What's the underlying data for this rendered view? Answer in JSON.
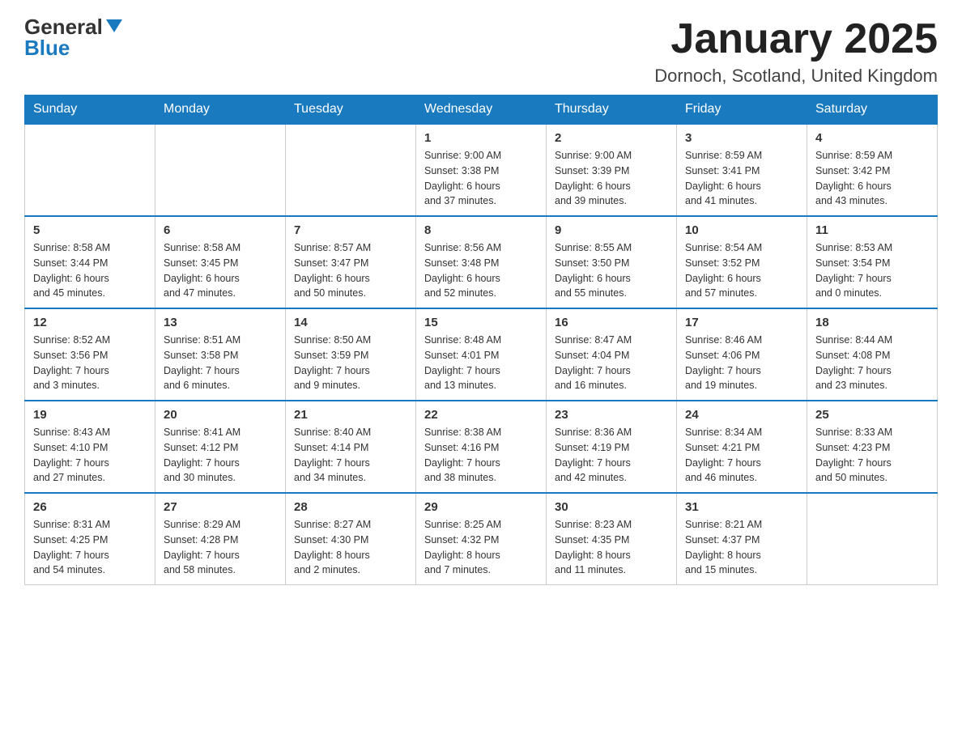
{
  "header": {
    "logo_general": "General",
    "logo_blue": "Blue",
    "month_title": "January 2025",
    "location": "Dornoch, Scotland, United Kingdom"
  },
  "weekdays": [
    "Sunday",
    "Monday",
    "Tuesday",
    "Wednesday",
    "Thursday",
    "Friday",
    "Saturday"
  ],
  "weeks": [
    [
      {
        "day": "",
        "info": ""
      },
      {
        "day": "",
        "info": ""
      },
      {
        "day": "",
        "info": ""
      },
      {
        "day": "1",
        "info": "Sunrise: 9:00 AM\nSunset: 3:38 PM\nDaylight: 6 hours\nand 37 minutes."
      },
      {
        "day": "2",
        "info": "Sunrise: 9:00 AM\nSunset: 3:39 PM\nDaylight: 6 hours\nand 39 minutes."
      },
      {
        "day": "3",
        "info": "Sunrise: 8:59 AM\nSunset: 3:41 PM\nDaylight: 6 hours\nand 41 minutes."
      },
      {
        "day": "4",
        "info": "Sunrise: 8:59 AM\nSunset: 3:42 PM\nDaylight: 6 hours\nand 43 minutes."
      }
    ],
    [
      {
        "day": "5",
        "info": "Sunrise: 8:58 AM\nSunset: 3:44 PM\nDaylight: 6 hours\nand 45 minutes."
      },
      {
        "day": "6",
        "info": "Sunrise: 8:58 AM\nSunset: 3:45 PM\nDaylight: 6 hours\nand 47 minutes."
      },
      {
        "day": "7",
        "info": "Sunrise: 8:57 AM\nSunset: 3:47 PM\nDaylight: 6 hours\nand 50 minutes."
      },
      {
        "day": "8",
        "info": "Sunrise: 8:56 AM\nSunset: 3:48 PM\nDaylight: 6 hours\nand 52 minutes."
      },
      {
        "day": "9",
        "info": "Sunrise: 8:55 AM\nSunset: 3:50 PM\nDaylight: 6 hours\nand 55 minutes."
      },
      {
        "day": "10",
        "info": "Sunrise: 8:54 AM\nSunset: 3:52 PM\nDaylight: 6 hours\nand 57 minutes."
      },
      {
        "day": "11",
        "info": "Sunrise: 8:53 AM\nSunset: 3:54 PM\nDaylight: 7 hours\nand 0 minutes."
      }
    ],
    [
      {
        "day": "12",
        "info": "Sunrise: 8:52 AM\nSunset: 3:56 PM\nDaylight: 7 hours\nand 3 minutes."
      },
      {
        "day": "13",
        "info": "Sunrise: 8:51 AM\nSunset: 3:58 PM\nDaylight: 7 hours\nand 6 minutes."
      },
      {
        "day": "14",
        "info": "Sunrise: 8:50 AM\nSunset: 3:59 PM\nDaylight: 7 hours\nand 9 minutes."
      },
      {
        "day": "15",
        "info": "Sunrise: 8:48 AM\nSunset: 4:01 PM\nDaylight: 7 hours\nand 13 minutes."
      },
      {
        "day": "16",
        "info": "Sunrise: 8:47 AM\nSunset: 4:04 PM\nDaylight: 7 hours\nand 16 minutes."
      },
      {
        "day": "17",
        "info": "Sunrise: 8:46 AM\nSunset: 4:06 PM\nDaylight: 7 hours\nand 19 minutes."
      },
      {
        "day": "18",
        "info": "Sunrise: 8:44 AM\nSunset: 4:08 PM\nDaylight: 7 hours\nand 23 minutes."
      }
    ],
    [
      {
        "day": "19",
        "info": "Sunrise: 8:43 AM\nSunset: 4:10 PM\nDaylight: 7 hours\nand 27 minutes."
      },
      {
        "day": "20",
        "info": "Sunrise: 8:41 AM\nSunset: 4:12 PM\nDaylight: 7 hours\nand 30 minutes."
      },
      {
        "day": "21",
        "info": "Sunrise: 8:40 AM\nSunset: 4:14 PM\nDaylight: 7 hours\nand 34 minutes."
      },
      {
        "day": "22",
        "info": "Sunrise: 8:38 AM\nSunset: 4:16 PM\nDaylight: 7 hours\nand 38 minutes."
      },
      {
        "day": "23",
        "info": "Sunrise: 8:36 AM\nSunset: 4:19 PM\nDaylight: 7 hours\nand 42 minutes."
      },
      {
        "day": "24",
        "info": "Sunrise: 8:34 AM\nSunset: 4:21 PM\nDaylight: 7 hours\nand 46 minutes."
      },
      {
        "day": "25",
        "info": "Sunrise: 8:33 AM\nSunset: 4:23 PM\nDaylight: 7 hours\nand 50 minutes."
      }
    ],
    [
      {
        "day": "26",
        "info": "Sunrise: 8:31 AM\nSunset: 4:25 PM\nDaylight: 7 hours\nand 54 minutes."
      },
      {
        "day": "27",
        "info": "Sunrise: 8:29 AM\nSunset: 4:28 PM\nDaylight: 7 hours\nand 58 minutes."
      },
      {
        "day": "28",
        "info": "Sunrise: 8:27 AM\nSunset: 4:30 PM\nDaylight: 8 hours\nand 2 minutes."
      },
      {
        "day": "29",
        "info": "Sunrise: 8:25 AM\nSunset: 4:32 PM\nDaylight: 8 hours\nand 7 minutes."
      },
      {
        "day": "30",
        "info": "Sunrise: 8:23 AM\nSunset: 4:35 PM\nDaylight: 8 hours\nand 11 minutes."
      },
      {
        "day": "31",
        "info": "Sunrise: 8:21 AM\nSunset: 4:37 PM\nDaylight: 8 hours\nand 15 minutes."
      },
      {
        "day": "",
        "info": ""
      }
    ]
  ]
}
